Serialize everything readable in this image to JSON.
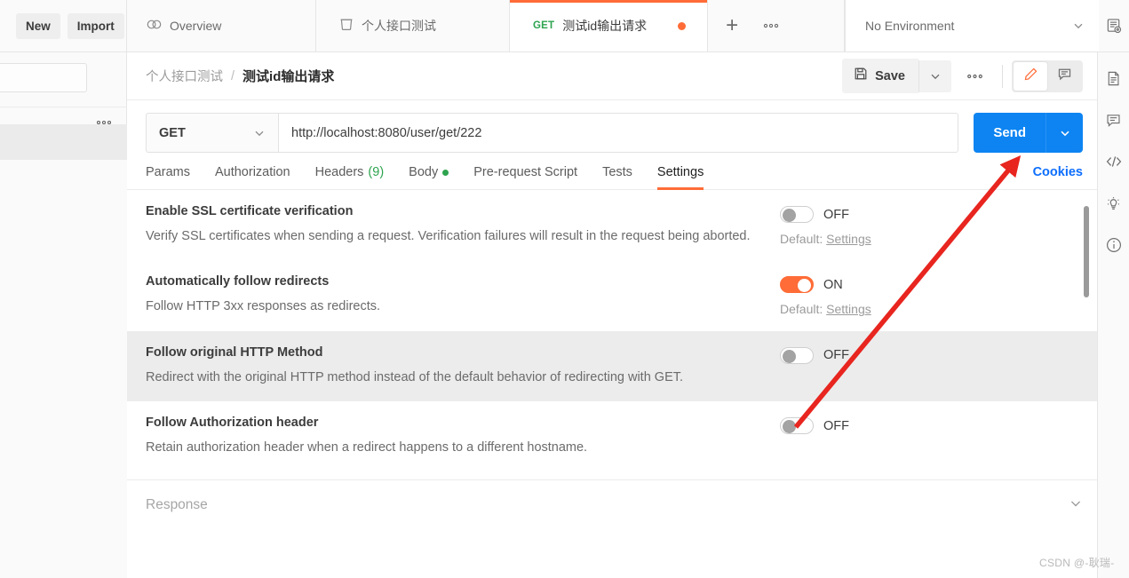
{
  "topbar": {
    "new_label": "New",
    "import_label": "Import",
    "tabs": [
      {
        "label": "Overview",
        "icon": "postman-overview-icon"
      },
      {
        "label": "个人接口测试",
        "icon": "collection-icon"
      }
    ],
    "active_tab": {
      "method": "GET",
      "title": "测试id输出请求",
      "unsaved": true
    },
    "add_tab_label": "+",
    "more_tabs_label": "⋯",
    "environment": {
      "selected": "No Environment",
      "eye_icon": "environment-quick-look-icon"
    }
  },
  "request_header": {
    "breadcrumb_collection": "个人接口测试",
    "breadcrumb_separator": "/",
    "breadcrumb_request": "测试id输出请求",
    "save_label": "Save",
    "save_icon": "floppy-disk-icon",
    "more_icon": "ellipsis-icon",
    "edit_icon": "pencil-icon",
    "comment_icon": "comment-icon"
  },
  "url_bar": {
    "method": "GET",
    "url": "http://localhost:8080/user/get/222",
    "send_label": "Send"
  },
  "request_tabs": {
    "items": [
      {
        "label": "Params",
        "active": false
      },
      {
        "label": "Authorization",
        "active": false
      },
      {
        "label": "Headers",
        "count": "(9)",
        "active": false
      },
      {
        "label": "Body",
        "dot": true,
        "active": false
      },
      {
        "label": "Pre-request Script",
        "active": false
      },
      {
        "label": "Tests",
        "active": false
      },
      {
        "label": "Settings",
        "active": true
      }
    ],
    "cookies_label": "Cookies"
  },
  "settings": {
    "rows": [
      {
        "title": "Enable SSL certificate verification",
        "desc": "Verify SSL certificates when sending a request. Verification failures will result in the request being aborted.",
        "state": "OFF",
        "on": false,
        "default_prefix": "Default:",
        "default_link": "Settings",
        "highlighted": false
      },
      {
        "title": "Automatically follow redirects",
        "desc": "Follow HTTP 3xx responses as redirects.",
        "state": "ON",
        "on": true,
        "default_prefix": "Default:",
        "default_link": "Settings",
        "highlighted": false
      },
      {
        "title": "Follow original HTTP Method",
        "desc": "Redirect with the original HTTP method instead of the default behavior of redirecting with GET.",
        "state": "OFF",
        "on": false,
        "default_prefix": "",
        "default_link": "",
        "highlighted": true
      },
      {
        "title": "Follow Authorization header",
        "desc": "Retain authorization header when a redirect happens to a different hostname.",
        "state": "OFF",
        "on": false,
        "default_prefix": "",
        "default_link": "",
        "highlighted": false
      }
    ]
  },
  "response": {
    "title": "Response",
    "caret_icon": "chevron-down-icon"
  },
  "right_rail": {
    "icons": [
      "documentation-icon",
      "comments-icon",
      "code-snippet-icon",
      "mock-lightbulb-icon",
      "info-icon"
    ]
  },
  "annotation": {
    "type": "red-arrow",
    "points_to": "Send"
  },
  "watermark": "CSDN @-耿瑞-",
  "colors": {
    "accent_orange": "#ff6c37",
    "send_blue": "#0d84f2",
    "link_blue": "#0d6efd",
    "method_green": "#2ea44f",
    "annotation_red": "#e8251f"
  }
}
